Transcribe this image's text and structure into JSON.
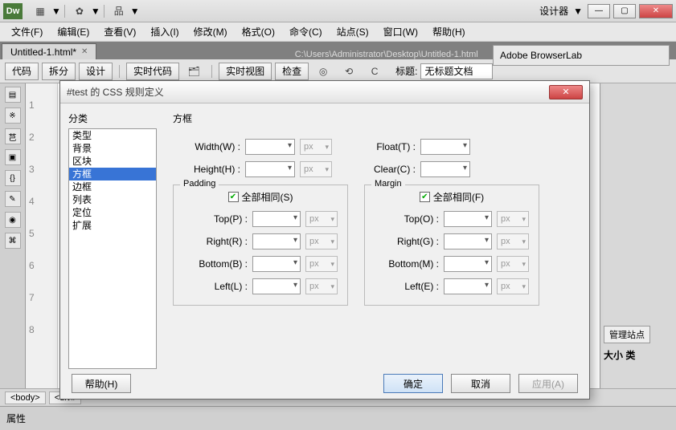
{
  "titlebar": {
    "designer_label": "设计器"
  },
  "menu": {
    "file": "文件(F)",
    "edit": "编辑(E)",
    "view": "查看(V)",
    "insert": "插入(I)",
    "modify": "修改(M)",
    "format": "格式(O)",
    "commands": "命令(C)",
    "site": "站点(S)",
    "window": "窗口(W)",
    "help": "帮助(H)"
  },
  "tabs": {
    "t1": "Untitled-1.html*",
    "path": "C:\\Users\\Administrator\\Desktop\\Untitled-1.html"
  },
  "panel": {
    "browserlab": "Adobe BrowserLab"
  },
  "toolbar": {
    "code": "代码",
    "split": "拆分",
    "design": "设计",
    "livecode": "实时代码",
    "liveview": "实时视图",
    "inspect": "检查",
    "title_label": "标题:",
    "title_value": "无标题文档"
  },
  "right": {
    "manage_site": "管理站点",
    "size_type": "大小 类"
  },
  "status": {
    "body": "<body>",
    "div": "<div#"
  },
  "props": {
    "label": "属性"
  },
  "dialog": {
    "title": "#test 的 CSS 规则定义",
    "category_label": "分类",
    "categories": [
      "类型",
      "背景",
      "区块",
      "方框",
      "边框",
      "列表",
      "定位",
      "扩展"
    ],
    "selected_index": 3,
    "section_title": "方框",
    "width_label": "Width(W) :",
    "height_label": "Height(H) :",
    "float_label": "Float(T) :",
    "clear_label": "Clear(C) :",
    "padding_legend": "Padding",
    "margin_legend": "Margin",
    "same_all_s": "全部相同(S)",
    "same_all_f": "全部相同(F)",
    "top_p": "Top(P) :",
    "right_r": "Right(R) :",
    "bottom_b": "Bottom(B) :",
    "left_l": "Left(L) :",
    "top_o": "Top(O) :",
    "right_g": "Right(G) :",
    "bottom_m": "Bottom(M) :",
    "left_e": "Left(E) :",
    "unit": "px",
    "help": "帮助(H)",
    "ok": "确定",
    "cancel": "取消",
    "apply": "应用(A)"
  }
}
